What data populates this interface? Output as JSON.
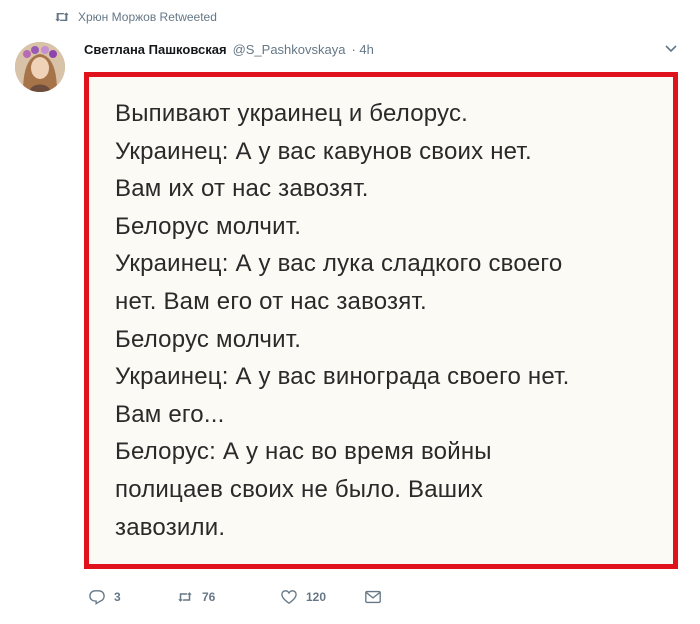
{
  "retweet_banner": {
    "text": "Хрюн Моржов Retweeted",
    "icon": "retweet-icon"
  },
  "tweet": {
    "author_name": "Светлана Пашковская",
    "handle": "@S_Pashkovskaya",
    "time": "· 4h",
    "image_lines": [
      "Выпивают украинец и белорус.",
      "Украинец: А у вас кавунов своих нет.",
      "Вам их от нас завозят.",
      "Белорус молчит.",
      "Украинец: А у вас лука сладкого своего",
      "нет. Вам его от нас завозят.",
      "Белорус молчит.",
      "Украинец: А у вас винограда своего нет.",
      "Вам его...",
      "Белорус: А у нас во время войны",
      "полицаев своих не было. Ваших",
      "завозили."
    ]
  },
  "actions": {
    "replies": "3",
    "retweets": "76",
    "likes": "120"
  },
  "colors": {
    "highlight_border": "#e0121b",
    "muted": "#657786",
    "retweet_green": "#17bf63"
  }
}
